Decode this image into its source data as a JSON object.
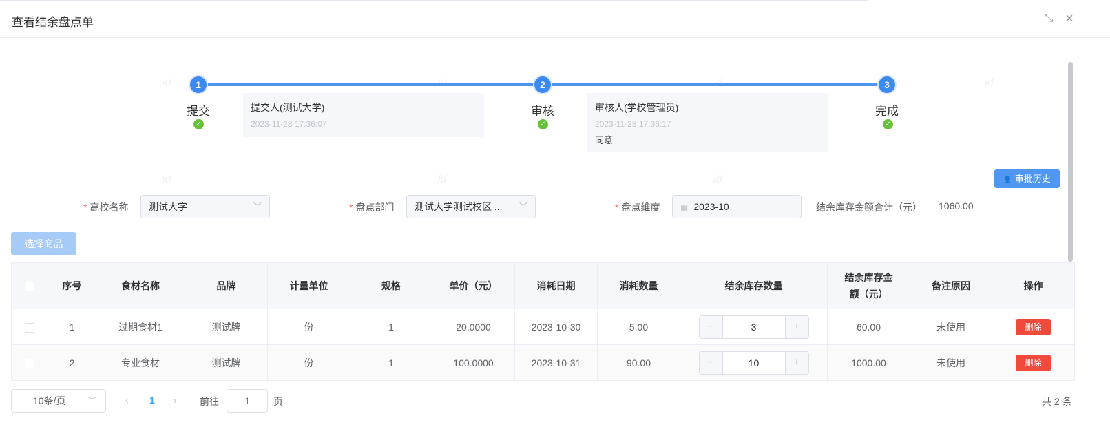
{
  "dialog": {
    "title": "查看结余盘点单",
    "shrink_icon": "⤡",
    "close_icon": "×"
  },
  "steps": [
    {
      "num": "1",
      "label": "提交",
      "done": "✓"
    },
    {
      "num": "2",
      "label": "审核",
      "done": "✓"
    },
    {
      "num": "3",
      "label": "完成",
      "done": "✓"
    }
  ],
  "records": [
    {
      "who": "提交人(测试大学)",
      "time": "2023-11-28 17:36:07"
    },
    {
      "who": "审核人(学校管理员)",
      "time": "2023-11-28 17:36:17",
      "note": "同意"
    }
  ],
  "watermark_text": "id",
  "history_button": {
    "icon": "user-icon",
    "label": "审批历史"
  },
  "form": {
    "school": {
      "label": "高校名称",
      "value": "测试大学"
    },
    "dept": {
      "label": "盘点部门",
      "value": "测试大学测试校区 ..."
    },
    "period": {
      "label": "盘点维度",
      "value": "2023-10"
    },
    "required_mark": "*",
    "sum_label": "结余库存金额合计（元）",
    "sum_value": "1060.00"
  },
  "select_goods_button": "选择商品",
  "table": {
    "headers": [
      "序号",
      "食材名称",
      "品牌",
      "计量单位",
      "规格",
      "单价（元）",
      "消耗日期",
      "消耗数量",
      "结余库存数量",
      "结余库存金额（元）",
      "备注原因",
      "操作"
    ],
    "rows": [
      {
        "index": "1",
        "name": "过期食材1",
        "brand": "测试牌",
        "unit": "份",
        "spec": "1",
        "price": "20.0000",
        "date": "2023-10-30",
        "consumed": "5.00",
        "stock": "3",
        "amount": "60.00",
        "remark": "未使用",
        "action": "删除"
      },
      {
        "index": "2",
        "name": "专业食材",
        "brand": "测试牌",
        "unit": "份",
        "spec": "1",
        "price": "100.0000",
        "date": "2023-10-31",
        "consumed": "90.00",
        "stock": "10",
        "amount": "1000.00",
        "remark": "未使用",
        "action": "删除"
      }
    ],
    "stepper_minus": "−",
    "stepper_plus": "+"
  },
  "pagination": {
    "page_size": "10条/页",
    "prev": "‹",
    "current": "1",
    "next": "›",
    "goto_label": "前往",
    "goto_value": "1",
    "page_suffix": "页",
    "total": "共 2 条"
  },
  "colors": {
    "primary": "#409eff",
    "step": "#3c8af0",
    "success": "#67c23a",
    "danger": "#f04a3c",
    "required": "#f56c6c"
  }
}
